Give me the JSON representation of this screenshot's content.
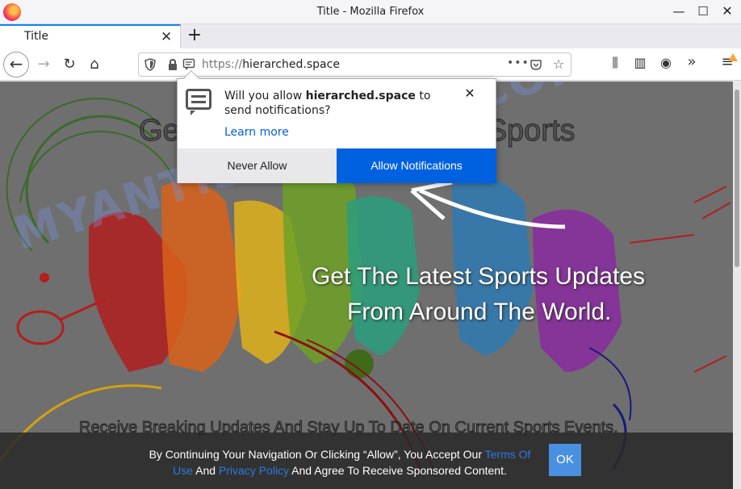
{
  "window": {
    "title": "Title - Mozilla Firefox",
    "minimize": "—",
    "maximize": "☐",
    "close": "✕"
  },
  "tabs": [
    {
      "label": "Title",
      "close": "✕"
    }
  ],
  "new_tab": "+",
  "nav": {
    "back": "←",
    "forward": "→",
    "reload": "↻",
    "home": "⌂",
    "url_scheme": "https://",
    "url_host": "hierarched.space",
    "page_actions": "•••",
    "pocket": "◡",
    "bookmark": "☆",
    "library": "⫼",
    "sidebar": "▥",
    "account": "◉",
    "overflow": "»",
    "menu": "≡"
  },
  "notification": {
    "message_prefix": "Will you allow ",
    "site": "hierarched.space",
    "message_suffix": " to send notifications?",
    "learn_more": "Learn more",
    "close": "✕",
    "never_allow": "Never Allow",
    "allow": "Allow Notifications"
  },
  "page": {
    "watermark": "MYANTISPYWARE.COM",
    "heading_left": "Ge",
    "heading_right": "Sports",
    "promo_line_1": "Get The Latest Sports Updates",
    "promo_line_2": "From Around The World.",
    "receive": "Receive Breaking Updates And Stay Up To Date On Current Sports Events."
  },
  "consent": {
    "text_1": "By Continuing Your Navigation Or Clicking “Allow”, You Accept Our ",
    "link_terms": "Terms Of Use",
    "text_2": " And ",
    "link_privacy": "Privacy Policy",
    "text_3": " And Agree To Receive Sponsored Content.",
    "ok": "OK"
  },
  "colors": {
    "accent": "#0061e0",
    "link": "#2a7ae2",
    "ok_button": "#4a90e2"
  }
}
